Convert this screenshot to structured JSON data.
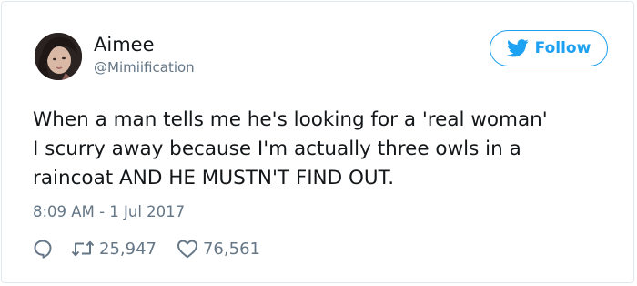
{
  "tweet": {
    "author_name": "Aimee",
    "author_handle": "@Mimiification",
    "follow_label": "Follow",
    "text_lines": [
      "When a man tells me he's looking for a 'real woman'",
      "I scurry away because I'm actually three owls in a",
      "raincoat AND HE MUSTN'T FIND OUT."
    ],
    "timestamp": "8:09 AM - 1 Jul 2017",
    "retweet_count": "25,947",
    "like_count": "76,561"
  },
  "icons": {
    "bird": "twitter-bird-icon",
    "reply": "reply-icon",
    "retweet": "retweet-icon",
    "like": "heart-icon"
  },
  "colors": {
    "accent": "#1da1f2",
    "text": "#14171a",
    "muted": "#657786",
    "border": "#e1e8ed"
  }
}
